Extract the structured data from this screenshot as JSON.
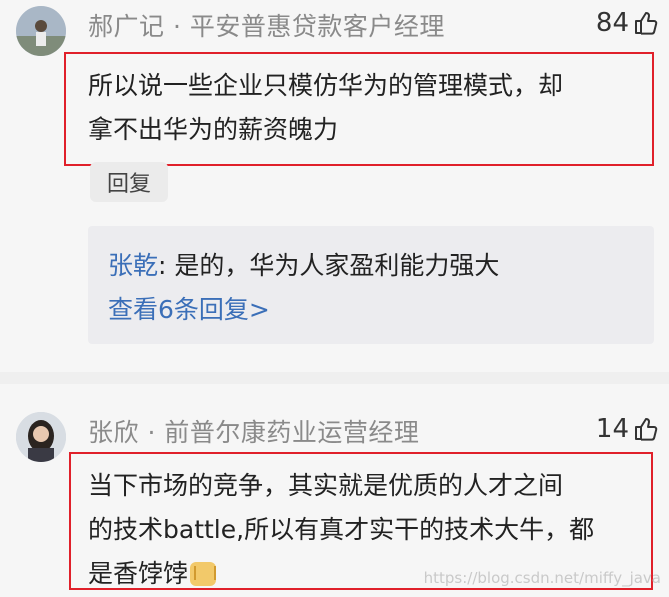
{
  "comments": [
    {
      "author": "郝广记 · 平安普惠贷款客户经理",
      "likes": "84",
      "lines": [
        "所以说一些企业只模仿华为的管理模式，却",
        "拿不出华为的薪资魄力"
      ],
      "reply_label": "回复",
      "sub_reply": {
        "author": "张乾",
        "text": ": 是的，华为人家盈利能力强大",
        "view_more": "查看6条回复>"
      }
    },
    {
      "author": "张欣 · 前普尔康药业运营经理",
      "likes": "14",
      "lines": [
        "当下市场的竞争，其实就是优质的人才之间",
        "的技术battle,所以有真才实干的技术大牛，都",
        "是香饽饽"
      ]
    }
  ],
  "watermark": "https://blog.csdn.net/miffy_java",
  "colors": {
    "highlight": "#e0202a",
    "link": "#3b6fb8"
  }
}
